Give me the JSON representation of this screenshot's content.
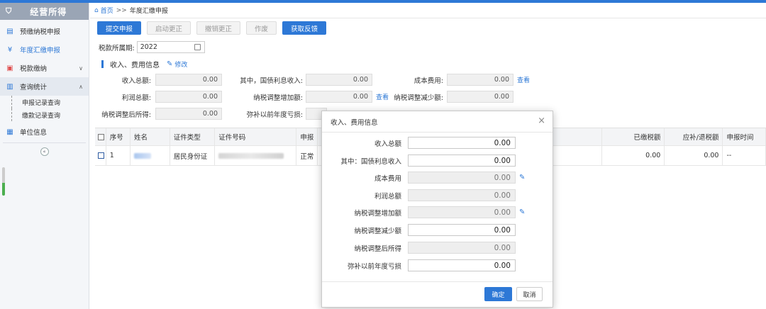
{
  "sidebar": {
    "brand": "经营所得",
    "items": [
      {
        "label": "预缴纳税申报",
        "icon": "clipboard-icon"
      },
      {
        "label": "年度汇缴申报",
        "icon": "yen-circle-icon"
      },
      {
        "label": "税款缴纳",
        "icon": "payment-icon"
      },
      {
        "label": "查询统计",
        "icon": "document-icon"
      },
      {
        "label": "单位信息",
        "icon": "table-icon"
      }
    ],
    "sub_items": [
      "申报记录查询",
      "缴款记录查询"
    ]
  },
  "breadcrumb": {
    "home": "首页",
    "sep": ">>",
    "current": "年度汇缴申报"
  },
  "toolbar": {
    "submit": "提交申报",
    "start_correction": "启动更正",
    "cancel_correction": "撤销更正",
    "void": "作废",
    "get_feedback": "获取反馈"
  },
  "period": {
    "label": "税款所属期:",
    "value": "2022"
  },
  "section": {
    "title": "收入、费用信息",
    "edit": "修改"
  },
  "fields": {
    "total_income": {
      "label": "收入总额:",
      "value": "0.00"
    },
    "bond_interest": {
      "label": "其中，国债利息收入:",
      "value": "0.00"
    },
    "cost": {
      "label": "成本费用:",
      "value": "0.00",
      "link": "查看"
    },
    "total_profit": {
      "label": "利润总额:",
      "value": "0.00"
    },
    "tax_adj_inc": {
      "label": "纳税调整增加额:",
      "value": "0.00",
      "link": "查看"
    },
    "tax_adj_dec": {
      "label": "纳税调整减少额:",
      "value": "0.00"
    },
    "adjusted_income": {
      "label": "纳税调整后所得:",
      "value": "0.00"
    },
    "prior_loss": {
      "label": "弥补以前年度亏损:"
    }
  },
  "table": {
    "headers": {
      "no": "序号",
      "name": "姓名",
      "id_type": "证件类型",
      "id_no": "证件号码",
      "decl": "申报",
      "paid": "已缴税额",
      "due": "应补/退税额",
      "decl_time": "申报时间"
    },
    "rows": [
      {
        "no": "1",
        "id_type": "居民身份证",
        "decl": "正常",
        "paid": "0.00",
        "due": "0.00",
        "decl_time": "--"
      }
    ]
  },
  "modal": {
    "title": "收入、费用信息",
    "close": "×",
    "rows": [
      {
        "label": "收入总额",
        "value": "0.00",
        "readonly": false
      },
      {
        "label": "其中：国债利息收入",
        "value": "0.00",
        "readonly": false
      },
      {
        "label": "成本费用",
        "value": "0.00",
        "readonly": true
      },
      {
        "label": "利润总额",
        "value": "0.00",
        "readonly": true
      },
      {
        "label": "纳税调整增加额",
        "value": "0.00",
        "readonly": true
      },
      {
        "label": "纳税调整减少额",
        "value": "0.00",
        "readonly": false
      },
      {
        "label": "纳税调整后所得",
        "value": "0.00",
        "readonly": true
      },
      {
        "label": "弥补以前年度亏损",
        "value": "0.00",
        "readonly": false
      }
    ],
    "ok": "确定",
    "cancel": "取消"
  },
  "colors": {
    "accent": "#2d78d6",
    "sidebar_head": "#9aa5b5"
  }
}
